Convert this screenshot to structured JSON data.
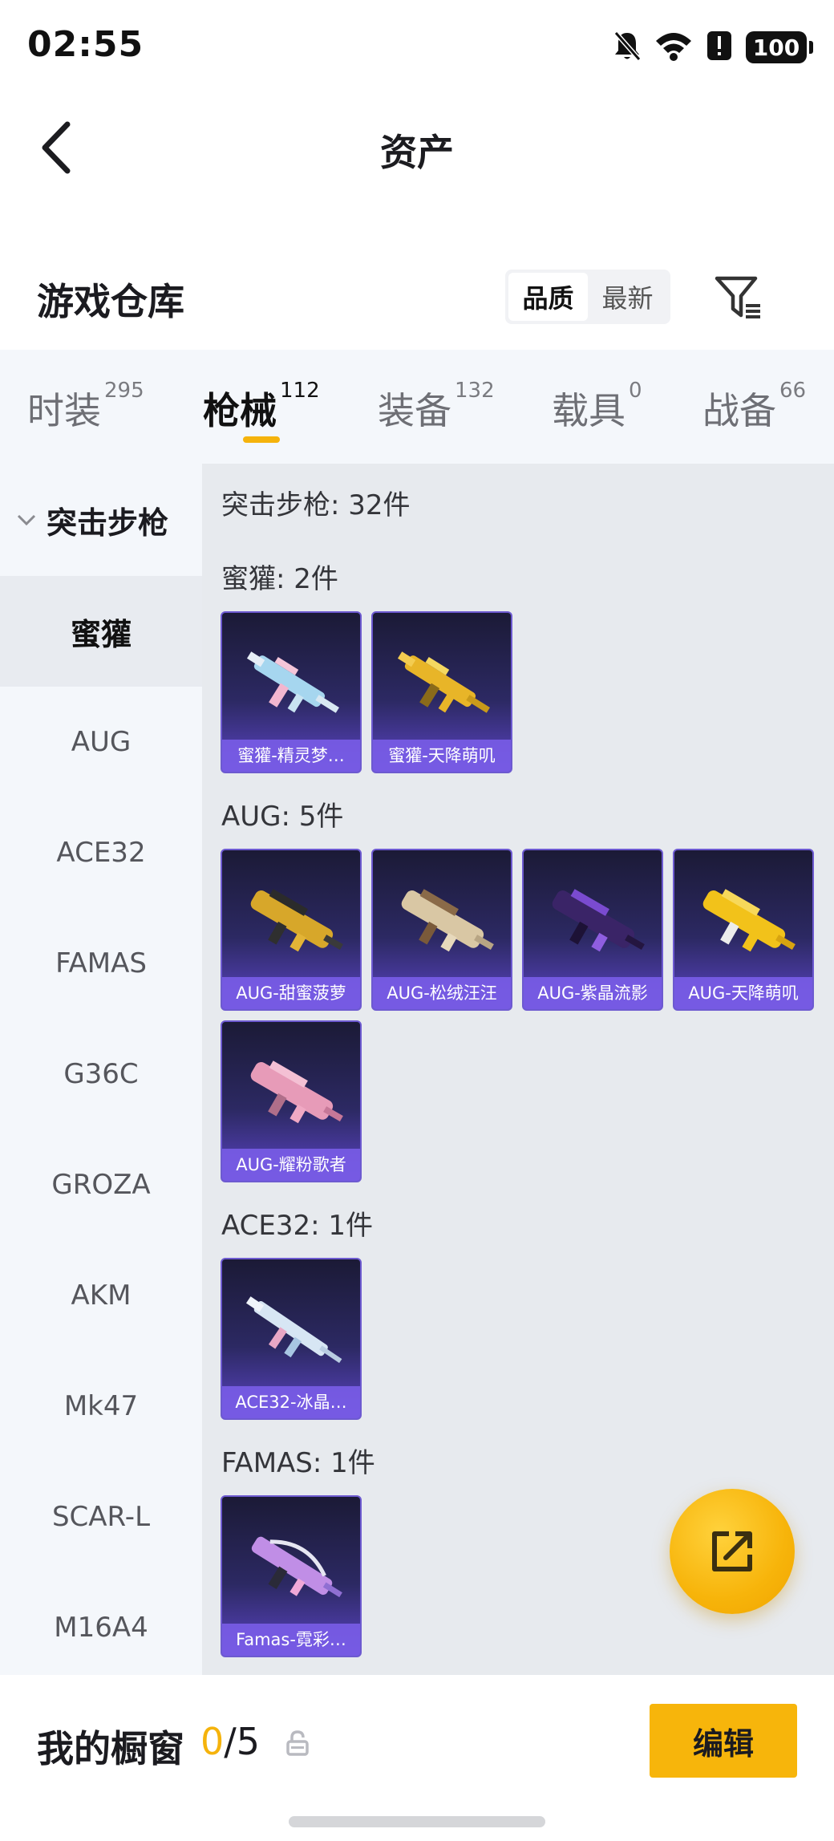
{
  "status_bar": {
    "time": "02:55",
    "battery": "100"
  },
  "nav": {
    "title": "资产"
  },
  "header": {
    "title": "游戏仓库"
  },
  "sort": {
    "options": [
      "品质",
      "最新"
    ],
    "selected": "品质"
  },
  "tabs": [
    {
      "label": "时装",
      "count": "295"
    },
    {
      "label": "枪械",
      "count": "112",
      "active": true
    },
    {
      "label": "装备",
      "count": "132"
    },
    {
      "label": "载具",
      "count": "0"
    },
    {
      "label": "战备",
      "count": "66"
    }
  ],
  "sidebar": {
    "group": "突击步枪",
    "items": [
      "蜜獾",
      "AUG",
      "ACE32",
      "FAMAS",
      "G36C",
      "GROZA",
      "AKM",
      "Mk47",
      "SCAR-L",
      "M16A4"
    ],
    "active": "蜜獾"
  },
  "main": {
    "summary": "突击步枪: 32件",
    "sections": [
      {
        "title": "蜜獾: 2件",
        "items": [
          "蜜獾-精灵梦…",
          "蜜獾-天降萌叽"
        ]
      },
      {
        "title": "AUG: 5件",
        "items": [
          "AUG-甜蜜菠萝",
          "AUG-松绒汪汪",
          "AUG-紫晶流影",
          "AUG-天降萌叽",
          "AUG-耀粉歌者"
        ]
      },
      {
        "title": "ACE32: 1件",
        "items": [
          "ACE32-冰晶…"
        ]
      },
      {
        "title": "FAMAS: 1件",
        "items": [
          "Famas-霓彩…"
        ]
      }
    ]
  },
  "bottom_bar": {
    "label": "我的橱窗",
    "count_current": "0",
    "count_total": "/5",
    "edit_label": "编辑"
  },
  "colors": {
    "accent": "#f5b30c",
    "card_border": "#6d5ad0",
    "card_label_bg": "#785ce6"
  }
}
